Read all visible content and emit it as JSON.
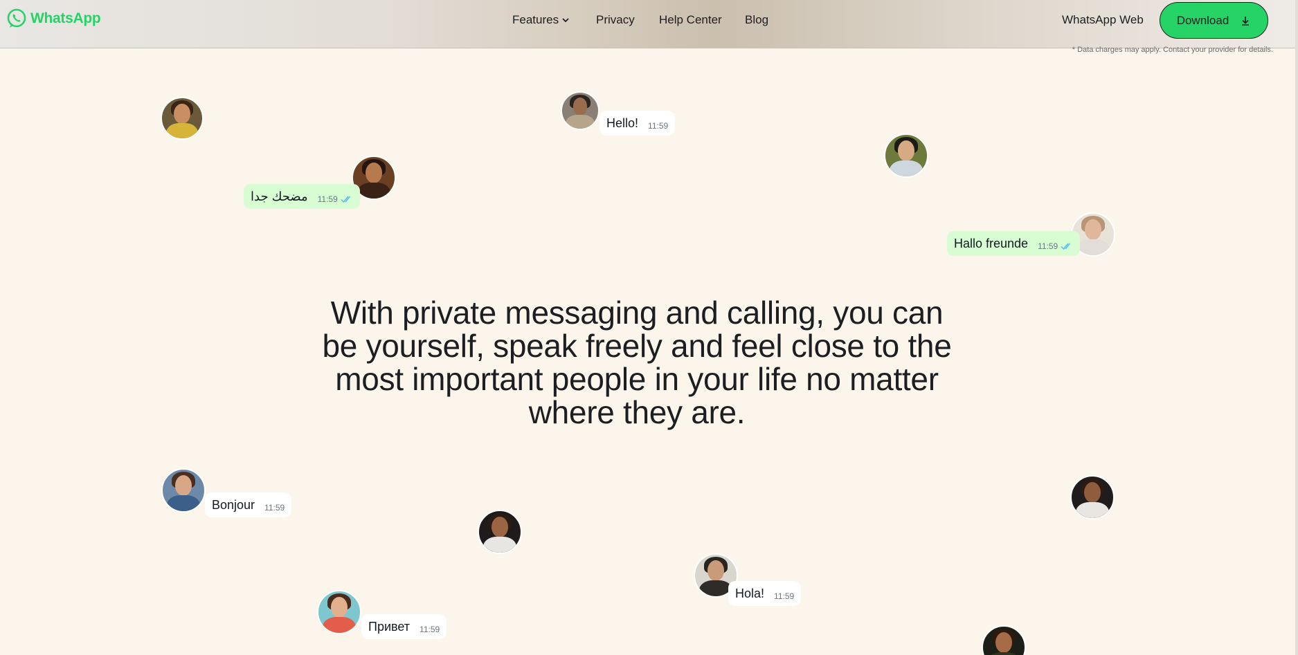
{
  "header": {
    "brand": "WhatsApp",
    "nav": [
      {
        "label": "Features",
        "has_dropdown": true
      },
      {
        "label": "Privacy"
      },
      {
        "label": "Help Center"
      },
      {
        "label": "Blog"
      }
    ],
    "web_link": "WhatsApp Web",
    "download_label": "Download",
    "disclaimer": "* Data charges may apply. Contact your provider for details."
  },
  "hero": {
    "text": "With private messaging and calling, you can be yourself, speak freely and feel close to the most important people in your life no matter where they are."
  },
  "messages": [
    {
      "text": "Hello!",
      "time": "11:59"
    },
    {
      "text": "مضحك جدا",
      "time": "11:59",
      "read": true
    },
    {
      "text": "Hallo freunde",
      "time": "11:59",
      "read": true
    },
    {
      "text": "Bonjour",
      "time": "11:59"
    },
    {
      "text": "Hola!",
      "time": "11:59"
    },
    {
      "text": "Привет",
      "time": "11:59"
    }
  ],
  "colors": {
    "brand": "#25d366",
    "background": "#fcf5eb",
    "bubble_outgoing": "#d9fdd3",
    "bubble_incoming": "#ffffff",
    "read_ticks": "#53bdeb"
  }
}
